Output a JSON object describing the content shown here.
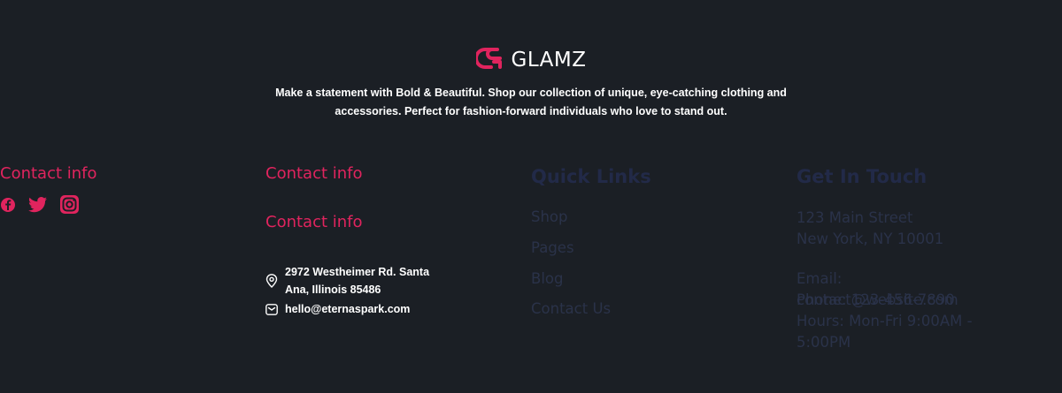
{
  "brand": {
    "name": "GLAMZ",
    "logo_icon": "glamz-logo-icon",
    "accent": "#e0245e",
    "tagline": "Make a statement with Bold & Beautiful. Shop our collection of unique, eye-catching clothing and accessories. Perfect for fashion-forward individuals who love to stand out."
  },
  "col1": {
    "heading": "Contact info",
    "social": [
      "facebook-icon",
      "twitter-icon",
      "instagram-icon"
    ]
  },
  "col2": {
    "heading1": "Contact info",
    "heading2": "Contact info",
    "address_line1": "2972 Westheimer Rd. Santa",
    "address_line2": "Ana, Illinois 85486",
    "email": "hello@eternaspark.com"
  },
  "quick_links": {
    "heading": "Quick Links",
    "items": [
      "Shop",
      "Pages",
      "Blog",
      "Contact Us"
    ]
  },
  "get_in_touch": {
    "heading": "Get In Touch",
    "street": "123 Main Street",
    "city": "New York, NY 10001",
    "email_label": "Email:",
    "email_value": "contact@website.com",
    "phone": "Phone: 123-456-7890",
    "hours": "Hours: Mon-Fri 9:00AM - 5:00PM"
  },
  "colors": {
    "background": "#1b1f25",
    "accent": "#e0245e",
    "faded_text": "#2a3249"
  }
}
